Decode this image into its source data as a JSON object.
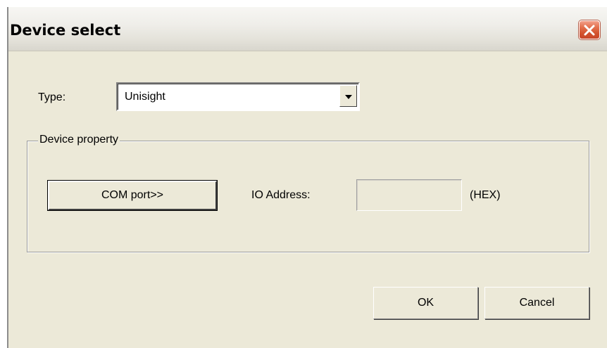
{
  "window": {
    "title": "Device select",
    "close_icon": "close-icon"
  },
  "type_row": {
    "label": "Type:",
    "selected_value": "Unisight",
    "dropdown_icon": "chevron-down-icon"
  },
  "device_property": {
    "group_title": "Device property",
    "com_port_button_label": "COM port>>",
    "io_address_label": "IO Address:",
    "io_address_value": "",
    "hex_label": "(HEX)"
  },
  "footer": {
    "ok_label": "OK",
    "cancel_label": "Cancel"
  },
  "colors": {
    "dialog_background": "#ECE9D8",
    "close_button_red": "#D2512D"
  }
}
